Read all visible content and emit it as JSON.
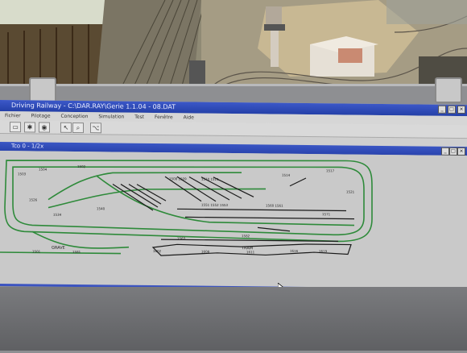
{
  "app": {
    "title": "Driving Railway - C:\\DAR.RAY\\Gerie 1.1.04 - 08.DAT",
    "menu": [
      "Fichier",
      "Pilotage",
      "Conception",
      "Simulation",
      "Test",
      "Fenêtre",
      "Aide"
    ],
    "toolbar_icons": [
      "open-folder-icon",
      "tools-icon",
      "lamp-icon",
      "cursor-icon",
      "zoom-icon",
      "tree-icon"
    ],
    "window_buttons": [
      "_",
      "□",
      "×"
    ]
  },
  "subwindow": {
    "title": "Tco 0 - 1/2x"
  },
  "track_labels": {
    "station": "GRAVE",
    "yard": "TRAM"
  },
  "colors": {
    "title_blue": "#2d46b4",
    "track_green": "#2e8a3a",
    "track_black": "#1a1a1a",
    "canvas_gray": "#c9c9c9"
  }
}
